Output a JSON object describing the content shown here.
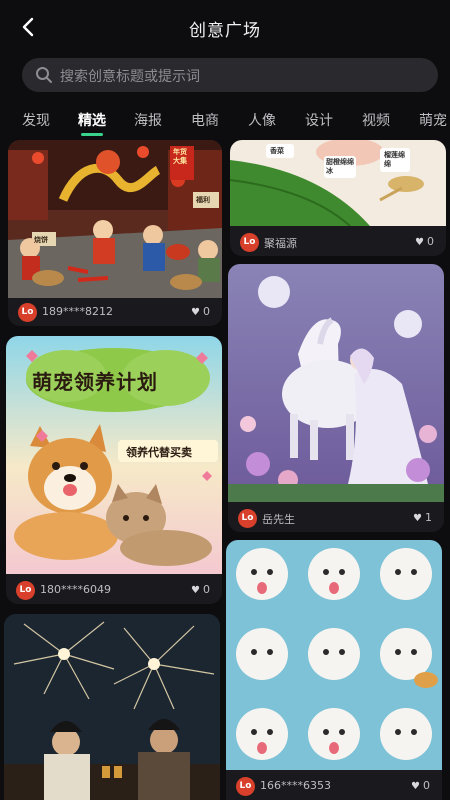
{
  "header": {
    "title": "创意广场",
    "back_icon": "back-chevron-icon"
  },
  "search": {
    "placeholder": "搜索创意标题或提示词",
    "icon": "search-icon"
  },
  "tabs": [
    {
      "label": "发现",
      "active": false
    },
    {
      "label": "精选",
      "active": true
    },
    {
      "label": "海报",
      "active": false
    },
    {
      "label": "电商",
      "active": false
    },
    {
      "label": "人像",
      "active": false
    },
    {
      "label": "设计",
      "active": false
    },
    {
      "label": "视频",
      "active": false
    },
    {
      "label": "萌宠",
      "active": false
    }
  ],
  "accent_color": "#3ad38c",
  "avatar_color": "#d8402b",
  "feed": {
    "left": [
      {
        "user": "189****8212",
        "likes": "0",
        "art": {
          "signs": [
            "年货大集",
            "烧饼",
            "福利"
          ]
        }
      },
      {
        "user": "180****6049",
        "likes": "0",
        "art": {
          "headline": "萌宠领养计划",
          "sub": "领养代替买卖"
        }
      },
      {
        "user": "",
        "likes": "",
        "art": {}
      }
    ],
    "right": [
      {
        "user": "聚福源",
        "likes": "0",
        "art": {
          "labels": [
            "香菜",
            "甜橙绵绵冰",
            "榴莲绵绵"
          ]
        }
      },
      {
        "user": "岳先生",
        "likes": "1",
        "art": {}
      },
      {
        "user": "166****6353",
        "likes": "0",
        "art": {}
      }
    ]
  },
  "avatar_text": "Lo"
}
